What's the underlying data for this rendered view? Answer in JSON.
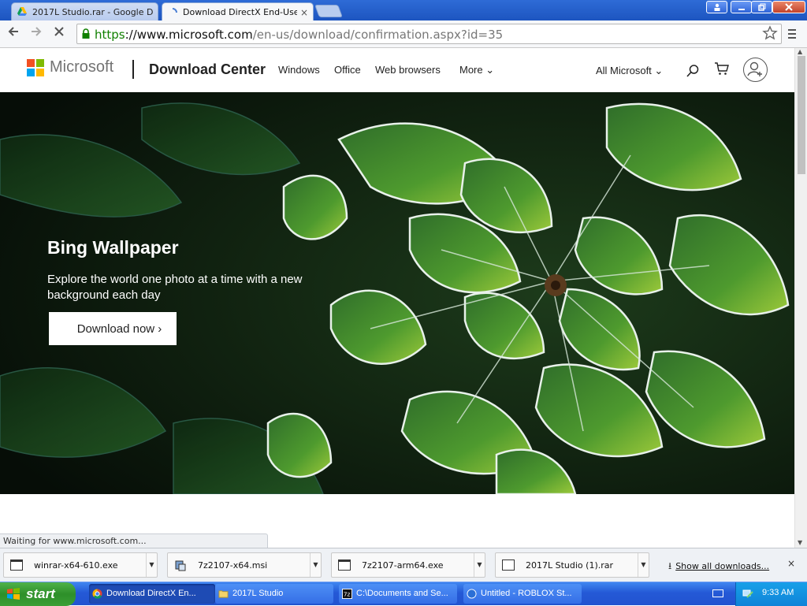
{
  "browser": {
    "tabs": [
      {
        "label": "2017L Studio.rar - Google D",
        "icon": "google-drive-icon"
      },
      {
        "label": "Download DirectX End-Use",
        "icon": "loading-icon",
        "close": "×"
      }
    ],
    "url_scheme": "https",
    "url_host": "://www.microsoft.com",
    "url_path": "/en-us/download/confirmation.aspx?id=35",
    "status_text": "Waiting for www.microsoft.com..."
  },
  "site": {
    "logo_text": "Microsoft",
    "section_title": "Download Center",
    "nav": [
      "Windows",
      "Office",
      "Web browsers",
      "More ⌄"
    ],
    "all_microsoft": "All Microsoft ⌄",
    "brand_colors": [
      "#f25022",
      "#7fba00",
      "#00a4ef",
      "#ffb900"
    ]
  },
  "hero": {
    "title": "Bing Wallpaper",
    "subtitle": "Explore the world one photo at a time with a new background each day",
    "button": "Download now ›"
  },
  "downloads": {
    "items": [
      "winrar-x64-610.exe",
      "7z2107-x64.msi",
      "7z2107-arm64.exe",
      "2017L Studio (1).rar"
    ],
    "show_all": "Show all downloads...",
    "close": "×"
  },
  "taskbar": {
    "start": "start",
    "tasks": [
      "Download DirectX En...",
      "2017L Studio",
      "C:\\Documents and Se...",
      "Untitled - ROBLOX St..."
    ],
    "clock": "9:33 AM"
  }
}
